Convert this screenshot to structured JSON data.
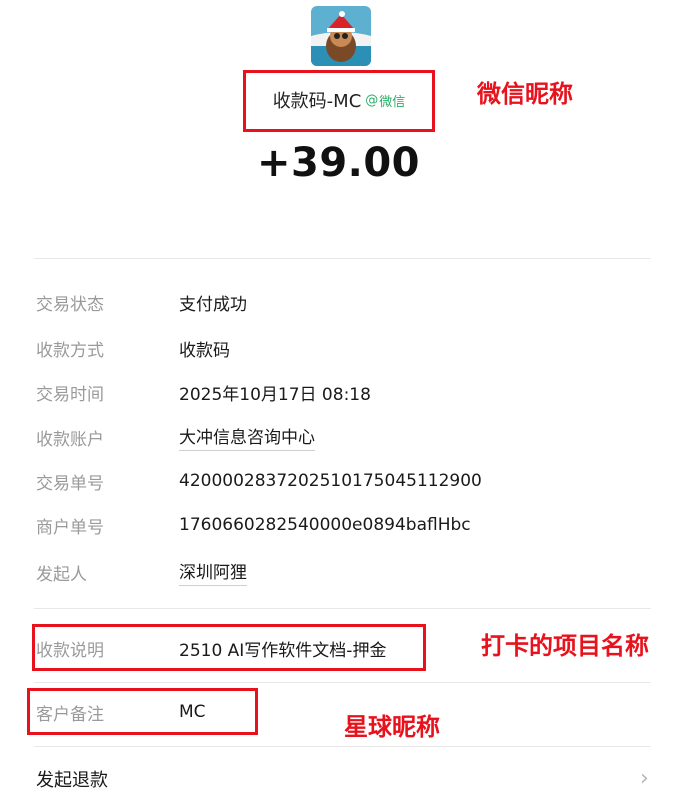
{
  "payment": {
    "merchant_name": "收款码-MC",
    "platform_tag": "微信",
    "amount": "+39.00"
  },
  "details": [
    {
      "label": "交易状态",
      "value": "支付成功"
    },
    {
      "label": "收款方式",
      "value": "收款码"
    },
    {
      "label": "交易时间",
      "value": "2025年10月17日 08:18"
    },
    {
      "label": "收款账户",
      "value": "大冲信息咨询中心"
    },
    {
      "label": "交易单号",
      "value": "4200002837202510175045112900"
    },
    {
      "label": "商户单号",
      "value": "1760660282540000e0894baflHbc"
    },
    {
      "label": "发起人",
      "value": "深圳阿狸"
    }
  ],
  "remark": {
    "label": "收款说明",
    "value": "2510 AI写作软件文档-押金"
  },
  "customer_note": {
    "label": "客户备注",
    "value": "MC"
  },
  "actions": {
    "refund_label": "发起退款"
  },
  "annotations": {
    "wechat_nickname": "微信昵称",
    "project_name": "打卡的项目名称",
    "planet_nickname": "星球昵称"
  },
  "colors": {
    "highlight": "#e8121d",
    "wechat_green": "#2aae67"
  }
}
